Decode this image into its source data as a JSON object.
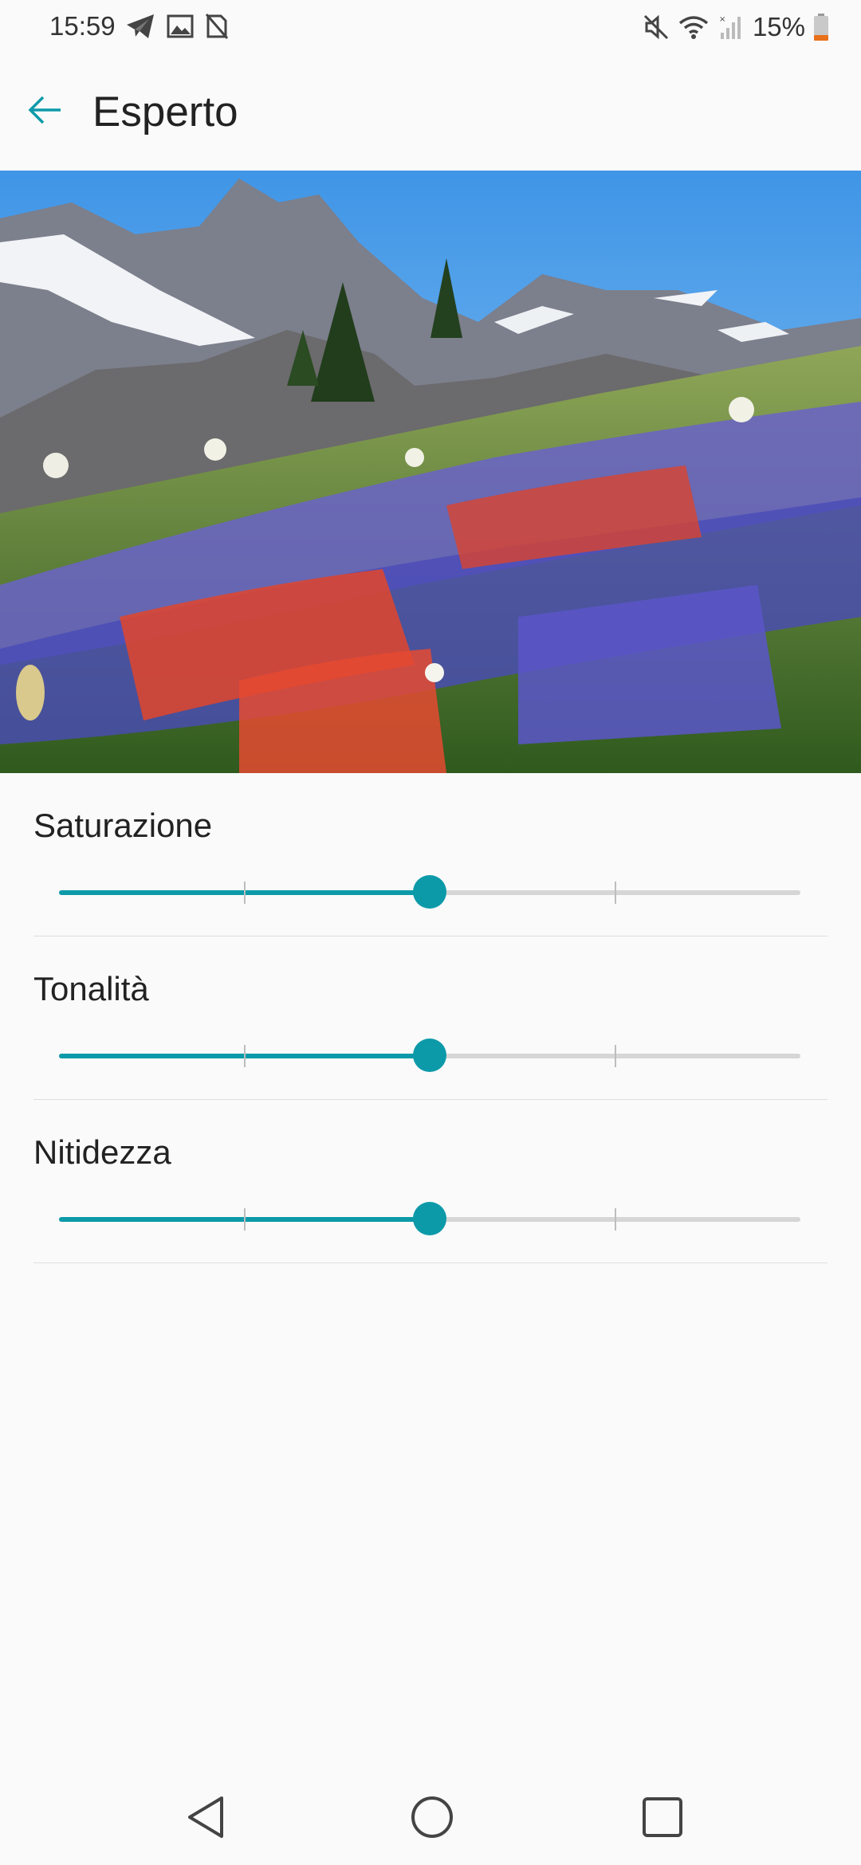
{
  "status_bar": {
    "time": "15:59",
    "left_icons": [
      "telegram-icon",
      "gallery-icon",
      "no-sim-icon"
    ],
    "right_icons": [
      "mute-icon",
      "wifi-icon",
      "signal-icon",
      "battery-icon"
    ],
    "battery": "15%"
  },
  "app_bar": {
    "title": "Esperto",
    "back_icon": "arrow-left-icon"
  },
  "preview": {
    "description_icon": "landscape-image"
  },
  "settings": [
    {
      "label": "Saturazione",
      "value": 0.5,
      "ticks": [
        0.25,
        0.75
      ]
    },
    {
      "label": "Tonalità",
      "value": 0.5,
      "ticks": [
        0.25,
        0.75
      ]
    },
    {
      "label": "Nitidezza",
      "value": 0.5,
      "ticks": [
        0.25,
        0.75
      ]
    }
  ],
  "nav_bar": {
    "back": "triangle-back-icon",
    "home": "circle-home-icon",
    "recents": "square-recents-icon"
  },
  "colors": {
    "accent": "#0c9aa9",
    "track": "#d6d6d6",
    "background": "#fafafa"
  }
}
